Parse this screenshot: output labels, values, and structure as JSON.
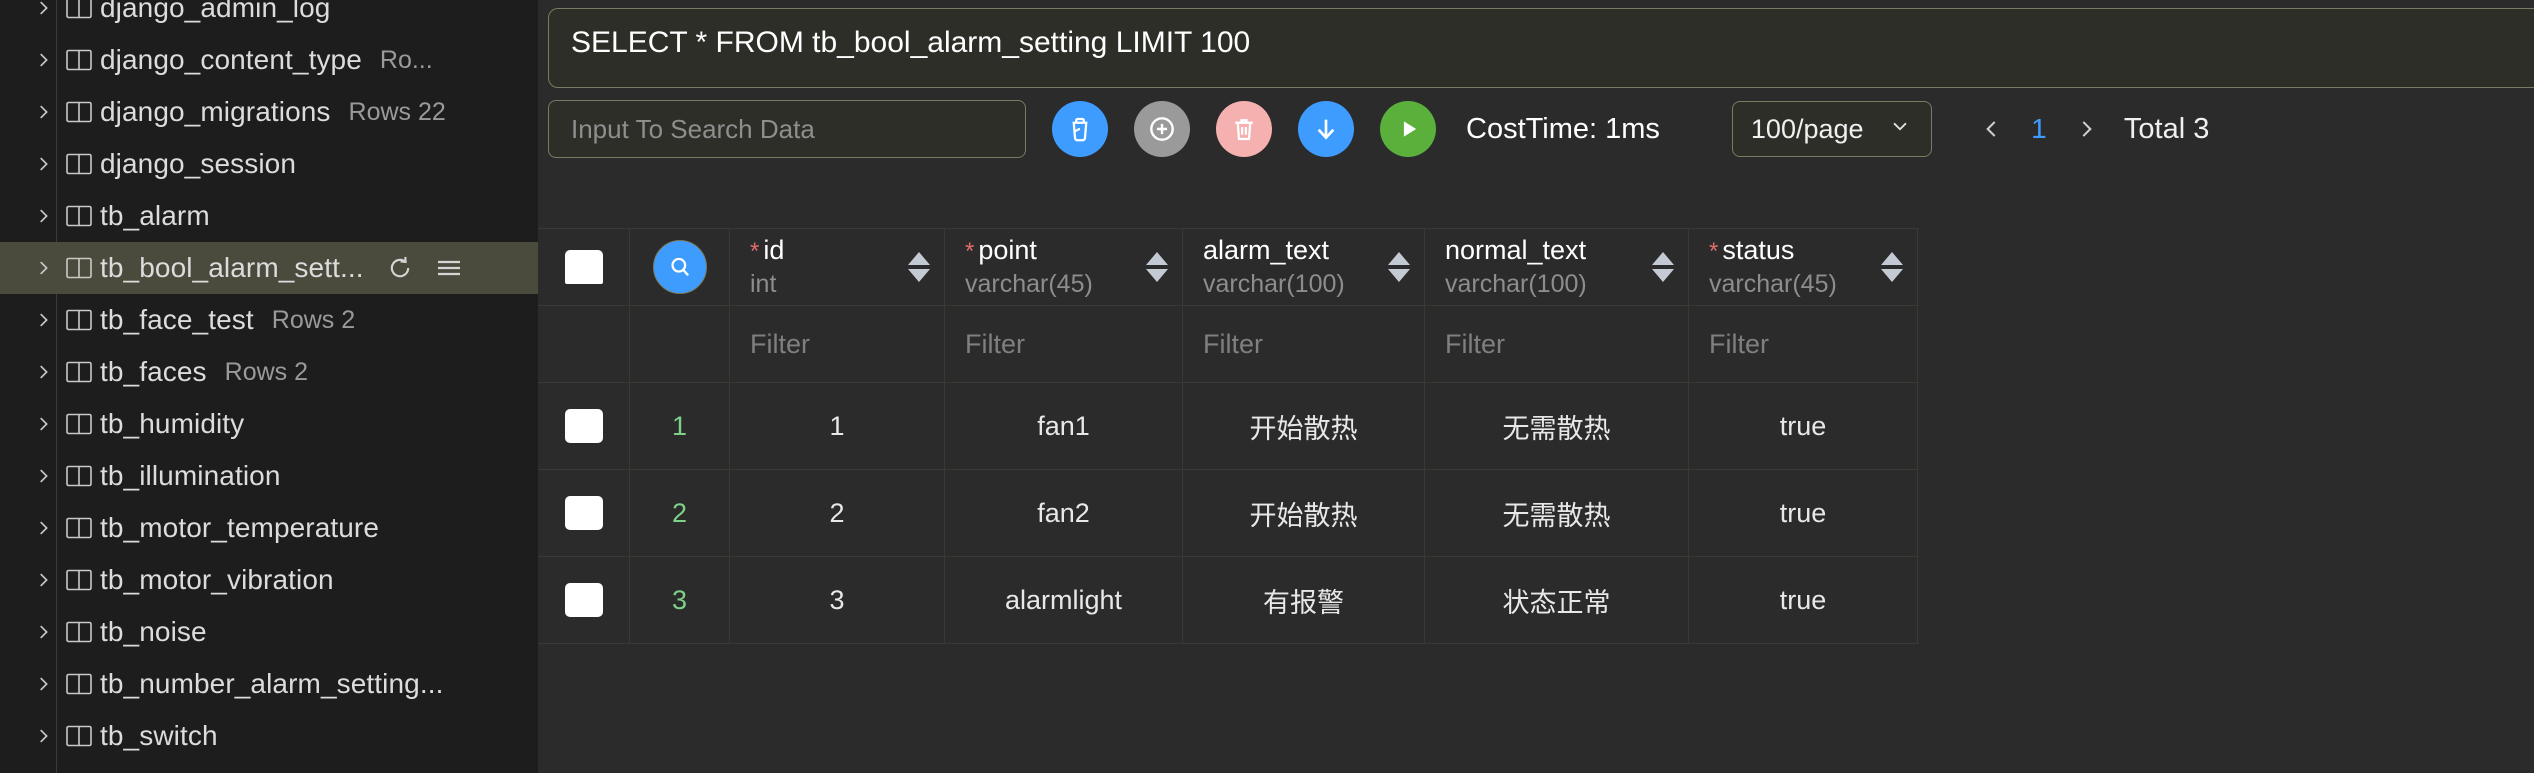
{
  "sidebar": {
    "items": [
      {
        "label": "django_admin_log",
        "meta": "",
        "selected": false,
        "clipped": true
      },
      {
        "label": "django_content_type",
        "meta": "Ro...",
        "selected": false
      },
      {
        "label": "django_migrations",
        "meta": "Rows 22",
        "selected": false
      },
      {
        "label": "django_session",
        "meta": "",
        "selected": false
      },
      {
        "label": "tb_alarm",
        "meta": "",
        "selected": false
      },
      {
        "label": "tb_bool_alarm_sett...",
        "meta": "",
        "selected": true,
        "actions": [
          "refresh-icon",
          "menu-icon"
        ]
      },
      {
        "label": "tb_face_test",
        "meta": "Rows 2",
        "selected": false
      },
      {
        "label": "tb_faces",
        "meta": "Rows 2",
        "selected": false
      },
      {
        "label": "tb_humidity",
        "meta": "",
        "selected": false
      },
      {
        "label": "tb_illumination",
        "meta": "",
        "selected": false
      },
      {
        "label": "tb_motor_temperature",
        "meta": "",
        "selected": false
      },
      {
        "label": "tb_motor_vibration",
        "meta": "",
        "selected": false
      },
      {
        "label": "tb_noise",
        "meta": "",
        "selected": false
      },
      {
        "label": "tb_number_alarm_setting...",
        "meta": "",
        "selected": false
      },
      {
        "label": "tb_switch",
        "meta": "",
        "selected": false
      }
    ]
  },
  "editor": {
    "sql": "SELECT * FROM tb_bool_alarm_setting LIMIT 100"
  },
  "toolbar": {
    "search_placeholder": "Input To Search Data",
    "search_value": "",
    "buttons": [
      {
        "name": "clear-button",
        "icon": "trash-cup-icon",
        "color": "#3e9cff"
      },
      {
        "name": "add-row-button",
        "icon": "plus-circle-icon",
        "color": "#9a9a9a"
      },
      {
        "name": "delete-row-button",
        "icon": "trash-icon",
        "color": "#f5b0b0"
      },
      {
        "name": "download-button",
        "icon": "arrow-down-icon",
        "color": "#3e9cff"
      },
      {
        "name": "execute-button",
        "icon": "play-icon",
        "color": "#5bb03c"
      }
    ],
    "cost_time": "CostTime: 1ms",
    "page_size": "100/page",
    "page_size_options": [
      "100/page"
    ],
    "pagination": {
      "prev": "‹",
      "current": "1",
      "next": "›",
      "total": "Total 3"
    }
  },
  "table": {
    "columns": [
      {
        "key": "checkbox",
        "name": "",
        "type": "",
        "required": false
      },
      {
        "key": "rownum",
        "name": "",
        "type": "",
        "required": false
      },
      {
        "key": "id",
        "name": "id",
        "type": "int",
        "required": true
      },
      {
        "key": "point",
        "name": "point",
        "type": "varchar(45)",
        "required": true
      },
      {
        "key": "alarm_text",
        "name": "alarm_text",
        "type": "varchar(100)",
        "required": false
      },
      {
        "key": "normal_text",
        "name": "normal_text",
        "type": "varchar(100)",
        "required": false
      },
      {
        "key": "status",
        "name": "status",
        "type": "varchar(45)",
        "required": true
      }
    ],
    "filter_placeholder": "Filter",
    "rows": [
      {
        "rownum": "1",
        "id": "1",
        "point": "fan1",
        "alarm_text": "开始散热",
        "normal_text": "无需散热",
        "status": "true"
      },
      {
        "rownum": "2",
        "id": "2",
        "point": "fan2",
        "alarm_text": "开始散热",
        "normal_text": "无需散热",
        "status": "true"
      },
      {
        "rownum": "3",
        "id": "3",
        "point": "alarmlight",
        "alarm_text": "有报警",
        "normal_text": "状态正常",
        "status": "true"
      }
    ]
  },
  "colors": {
    "accent_blue": "#3e9cff",
    "accent_green": "#5bb03c",
    "rownum_green": "#7fd18a",
    "required_red": "#e06c6c",
    "sidebar_selected": "#4b4b3d",
    "panel_border": "#7b7a62"
  }
}
